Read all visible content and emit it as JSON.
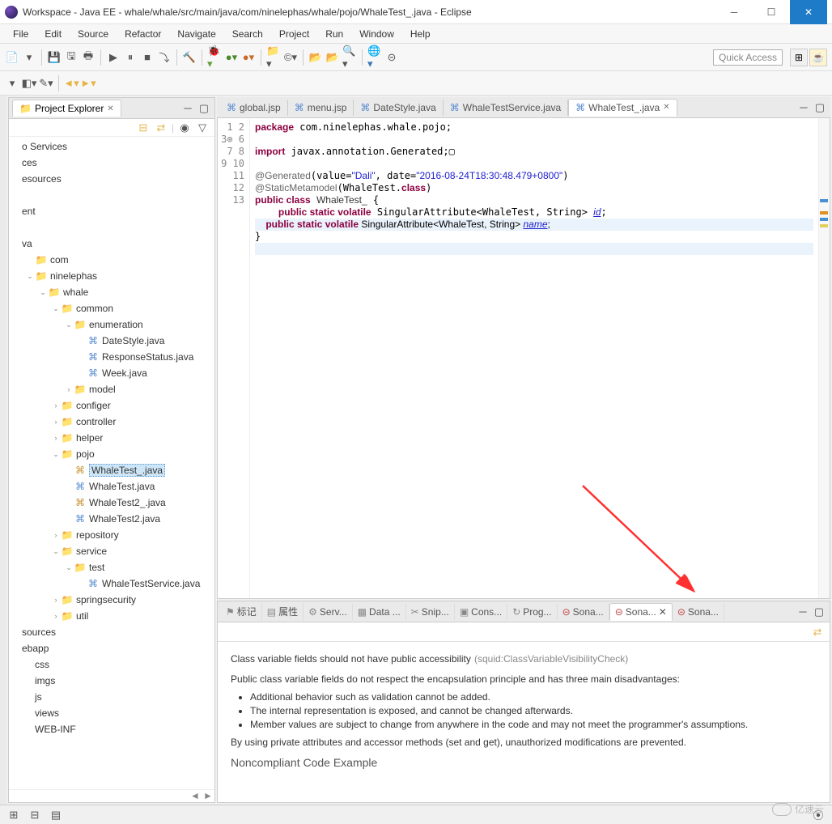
{
  "window": {
    "title": "Workspace - Java EE - whale/whale/src/main/java/com/ninelephas/whale/pojo/WhaleTest_.java - Eclipse"
  },
  "menu": [
    "File",
    "Edit",
    "Source",
    "Refactor",
    "Navigate",
    "Search",
    "Project",
    "Run",
    "Window",
    "Help"
  ],
  "quickaccess": "Quick Access",
  "explorer": {
    "title": "Project Explorer",
    "items": [
      {
        "lvl": 0,
        "label": "o Services",
        "arrow": ""
      },
      {
        "lvl": 0,
        "label": "ces",
        "arrow": ""
      },
      {
        "lvl": 0,
        "label": "esources",
        "arrow": ""
      },
      {
        "lvl": 0,
        "label": "",
        "arrow": ""
      },
      {
        "lvl": 0,
        "label": "ent",
        "arrow": ""
      },
      {
        "lvl": 0,
        "label": "",
        "arrow": ""
      },
      {
        "lvl": 0,
        "label": "va",
        "arrow": ""
      },
      {
        "lvl": 1,
        "label": "com",
        "arrow": "",
        "icon": "pkg"
      },
      {
        "lvl": 1,
        "label": "ninelephas",
        "arrow": "v",
        "icon": "pkg"
      },
      {
        "lvl": 2,
        "label": "whale",
        "arrow": "v",
        "icon": "pkg"
      },
      {
        "lvl": 3,
        "label": "common",
        "arrow": "v",
        "icon": "pkg"
      },
      {
        "lvl": 4,
        "label": "enumeration",
        "arrow": "v",
        "icon": "pkg"
      },
      {
        "lvl": 5,
        "label": "DateStyle.java",
        "arrow": "",
        "icon": "java"
      },
      {
        "lvl": 5,
        "label": "ResponseStatus.java",
        "arrow": "",
        "icon": "java"
      },
      {
        "lvl": 5,
        "label": "Week.java",
        "arrow": "",
        "icon": "java"
      },
      {
        "lvl": 4,
        "label": "model",
        "arrow": ">",
        "icon": "pkg"
      },
      {
        "lvl": 3,
        "label": "configer",
        "arrow": ">",
        "icon": "pkg"
      },
      {
        "lvl": 3,
        "label": "controller",
        "arrow": ">",
        "icon": "pkg"
      },
      {
        "lvl": 3,
        "label": "helper",
        "arrow": ">",
        "icon": "pkg"
      },
      {
        "lvl": 3,
        "label": "pojo",
        "arrow": "v",
        "icon": "pkg"
      },
      {
        "lvl": 4,
        "label": "WhaleTest_.java",
        "arrow": "",
        "icon": "gen",
        "selected": true
      },
      {
        "lvl": 4,
        "label": "WhaleTest.java",
        "arrow": "",
        "icon": "java"
      },
      {
        "lvl": 4,
        "label": "WhaleTest2_.java",
        "arrow": "",
        "icon": "gen"
      },
      {
        "lvl": 4,
        "label": "WhaleTest2.java",
        "arrow": "",
        "icon": "java"
      },
      {
        "lvl": 3,
        "label": "repository",
        "arrow": ">",
        "icon": "pkg"
      },
      {
        "lvl": 3,
        "label": "service",
        "arrow": "v",
        "icon": "pkg"
      },
      {
        "lvl": 4,
        "label": "test",
        "arrow": "v",
        "icon": "pkg"
      },
      {
        "lvl": 5,
        "label": "WhaleTestService.java",
        "arrow": "",
        "icon": "java"
      },
      {
        "lvl": 3,
        "label": "springsecurity",
        "arrow": ">",
        "icon": "pkg"
      },
      {
        "lvl": 3,
        "label": "util",
        "arrow": ">",
        "icon": "pkg"
      },
      {
        "lvl": 0,
        "label": "sources",
        "arrow": ""
      },
      {
        "lvl": 0,
        "label": "ebapp",
        "arrow": ""
      },
      {
        "lvl": 1,
        "label": "css",
        "arrow": ""
      },
      {
        "lvl": 1,
        "label": "imgs",
        "arrow": ""
      },
      {
        "lvl": 1,
        "label": "js",
        "arrow": ""
      },
      {
        "lvl": 1,
        "label": "views",
        "arrow": ""
      },
      {
        "lvl": 1,
        "label": "WEB-INF",
        "arrow": ""
      }
    ]
  },
  "editor_tabs": [
    {
      "label": "global.jsp",
      "active": false
    },
    {
      "label": "menu.jsp",
      "active": false
    },
    {
      "label": "DateStyle.java",
      "active": false
    },
    {
      "label": "WhaleTestService.java",
      "active": false
    },
    {
      "label": "WhaleTest_.java",
      "active": true
    }
  ],
  "code": {
    "lines": [
      1,
      2,
      3,
      6,
      7,
      8,
      9,
      10,
      11,
      12,
      13
    ]
  },
  "bottom_tabs": [
    {
      "label": "标记",
      "icon": "⚑"
    },
    {
      "label": "属性",
      "icon": "▤"
    },
    {
      "label": "Serv...",
      "icon": "⚙"
    },
    {
      "label": "Data ...",
      "icon": "▦"
    },
    {
      "label": "Snip...",
      "icon": "✂"
    },
    {
      "label": "Cons...",
      "icon": "▣"
    },
    {
      "label": "Prog...",
      "icon": "↻"
    },
    {
      "label": "Sona...",
      "icon": "⊝"
    },
    {
      "label": "Sona...",
      "icon": "⊝",
      "active": true
    },
    {
      "label": "Sona...",
      "icon": "⊝"
    }
  ],
  "rule": {
    "title": "Class variable fields should not have public accessibility",
    "id": "(squid:ClassVariableVisibilityCheck)",
    "desc": "Public class variable fields do not respect the encapsulation principle and has three main disadvantages:",
    "bullets": [
      "Additional behavior such as validation cannot be added.",
      "The internal representation is exposed, and cannot be changed afterwards.",
      "Member values are subject to change from anywhere in the code and may not meet the programmer's assumptions."
    ],
    "desc2": "By using private attributes and accessor methods (set and get), unauthorized modifications are prevented.",
    "heading2": "Noncompliant Code Example"
  },
  "watermark": "亿速云"
}
